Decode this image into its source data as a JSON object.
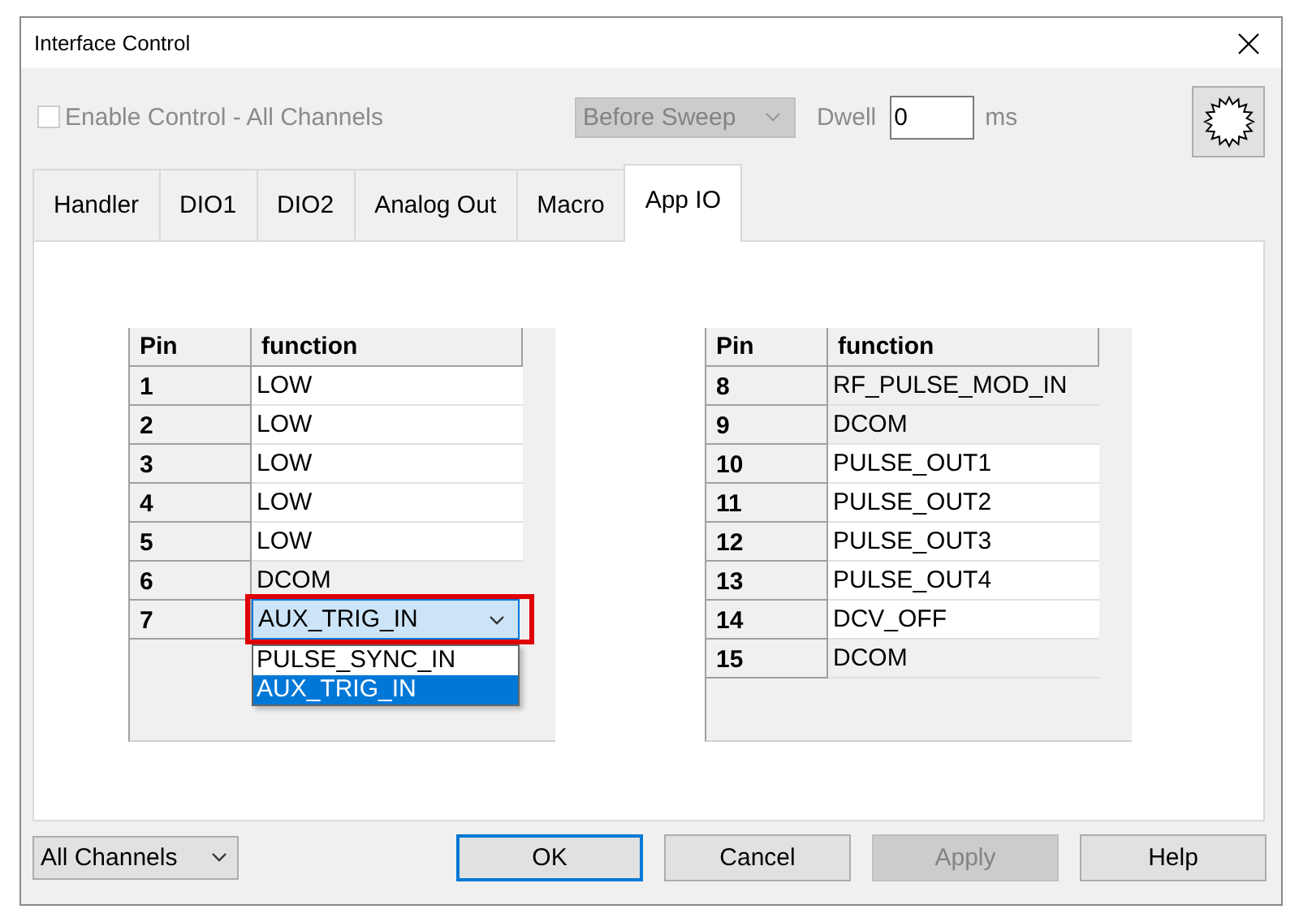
{
  "window": {
    "title": "Interface Control"
  },
  "enable_control": {
    "label": "Enable Control - All Channels",
    "checked": false,
    "disabled": true
  },
  "timing": {
    "value": "Before Sweep",
    "disabled": true
  },
  "dwell": {
    "label": "Dwell",
    "value": "0",
    "unit": "ms"
  },
  "tabs": [
    {
      "label": "Handler",
      "selected": false
    },
    {
      "label": "DIO1",
      "selected": false
    },
    {
      "label": "DIO2",
      "selected": false
    },
    {
      "label": "Analog Out",
      "selected": false
    },
    {
      "label": "Macro",
      "selected": false
    },
    {
      "label": "App IO",
      "selected": true
    }
  ],
  "tables": [
    {
      "columns": [
        "Pin",
        "function"
      ],
      "rows": [
        {
          "pin": "1",
          "function": "LOW",
          "kind": "text",
          "editable": true
        },
        {
          "pin": "2",
          "function": "LOW",
          "kind": "text",
          "editable": true
        },
        {
          "pin": "3",
          "function": "LOW",
          "kind": "text",
          "editable": true
        },
        {
          "pin": "4",
          "function": "LOW",
          "kind": "text",
          "editable": true
        },
        {
          "pin": "5",
          "function": "LOW",
          "kind": "text",
          "editable": true
        },
        {
          "pin": "6",
          "function": "DCOM",
          "kind": "text",
          "editable": false
        },
        {
          "pin": "7",
          "function": "AUX_TRIG_IN",
          "kind": "dropdown",
          "highlighted": true,
          "options": [
            {
              "label": "PULSE_SYNC_IN",
              "selected": false
            },
            {
              "label": "AUX_TRIG_IN",
              "selected": true
            }
          ]
        }
      ]
    },
    {
      "columns": [
        "Pin",
        "function"
      ],
      "rows": [
        {
          "pin": "8",
          "function": "RF_PULSE_MOD_IN",
          "kind": "text",
          "editable": false
        },
        {
          "pin": "9",
          "function": "DCOM",
          "kind": "text",
          "editable": false
        },
        {
          "pin": "10",
          "function": "PULSE_OUT1",
          "kind": "text",
          "editable": true
        },
        {
          "pin": "11",
          "function": "PULSE_OUT2",
          "kind": "text",
          "editable": true
        },
        {
          "pin": "12",
          "function": "PULSE_OUT3",
          "kind": "text",
          "editable": true
        },
        {
          "pin": "13",
          "function": "PULSE_OUT4",
          "kind": "text",
          "editable": true
        },
        {
          "pin": "14",
          "function": "DCV_OFF",
          "kind": "text",
          "editable": true
        },
        {
          "pin": "15",
          "function": "DCOM",
          "kind": "text",
          "editable": false
        }
      ]
    }
  ],
  "footer": {
    "channel_select": {
      "value": "All Channels"
    },
    "buttons": [
      {
        "label": "OK",
        "default": true,
        "disabled": false
      },
      {
        "label": "Cancel",
        "default": false,
        "disabled": false
      },
      {
        "label": "Apply",
        "default": false,
        "disabled": true
      },
      {
        "label": "Help",
        "default": false,
        "disabled": false
      }
    ]
  }
}
